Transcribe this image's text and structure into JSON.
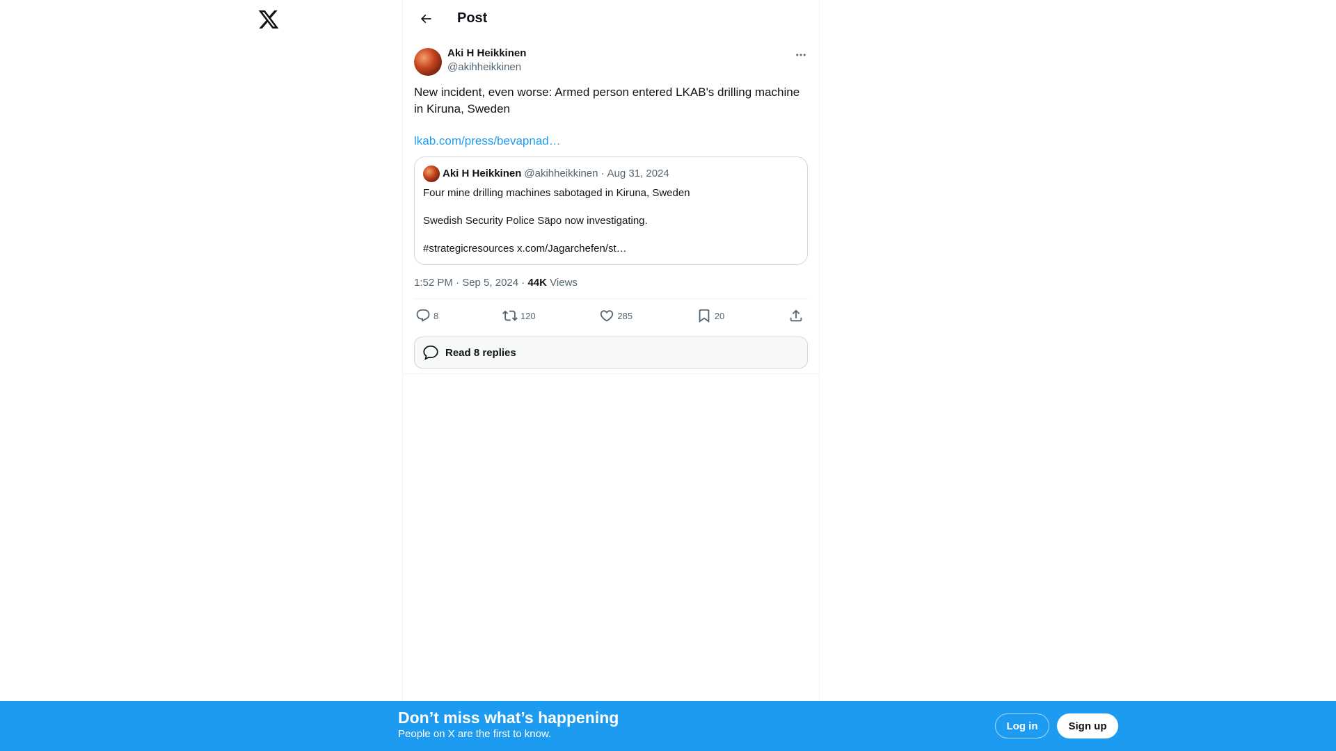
{
  "header": {
    "title": "Post"
  },
  "post": {
    "author_name": "Aki H Heikkinen",
    "author_handle": "@akihheikkinen",
    "text": "New incident, even worse: Armed person entered LKAB's  drilling machine in Kiruna, Sweden",
    "link": "lkab.com/press/bevapnad…",
    "quote": {
      "author_name": "Aki H Heikkinen",
      "author_handle": "@akihheikkinen",
      "separator": "·",
      "date": "Aug 31, 2024",
      "lines": [
        "Four mine drilling machines sabotaged in Kiruna, Sweden",
        "Swedish Security Police Säpo now investigating.",
        "#strategicresources x.com/Jagarchefen/st…"
      ]
    },
    "timestamp": "1:52 PM · Sep 5, 2024",
    "separator": "·",
    "views_count": "44K",
    "views_label": "Views",
    "stats": {
      "replies": "8",
      "reposts": "120",
      "likes": "285",
      "bookmarks": "20"
    },
    "read_replies_label": "Read 8 replies"
  },
  "banner": {
    "title": "Don’t miss what’s happening",
    "subtitle": "People on X are the first to know.",
    "login_label": "Log in",
    "signup_label": "Sign up"
  },
  "colors": {
    "accent": "#1d9bf0",
    "text_primary": "#0f1419",
    "text_secondary": "#536471"
  }
}
